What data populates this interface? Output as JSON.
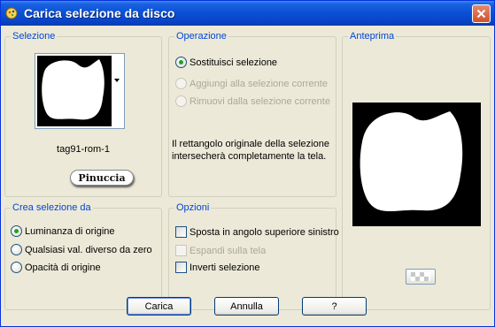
{
  "window": {
    "title": "Carica selezione da disco"
  },
  "selection": {
    "group_label": "Selezione",
    "file_name": "tag91-rom-1",
    "logo_text": "Pinuccia"
  },
  "operation": {
    "group_label": "Operazione",
    "options": [
      {
        "label": "Sostituisci selezione",
        "checked": true,
        "enabled": true
      },
      {
        "label": "Aggiungi alla selezione corrente",
        "checked": false,
        "enabled": false
      },
      {
        "label": "Rimuovi dalla selezione corrente",
        "checked": false,
        "enabled": false
      }
    ],
    "description": "Il rettangolo originale della selezione intersecherà completamente la tela."
  },
  "preview": {
    "group_label": "Anteprima"
  },
  "create_from": {
    "group_label": "Crea selezione da",
    "options": [
      {
        "label": "Luminanza di origine",
        "checked": true
      },
      {
        "label": "Qualsiasi val. diverso da zero",
        "checked": false
      },
      {
        "label": "Opacità di origine",
        "checked": false
      }
    ]
  },
  "options": {
    "group_label": "Opzioni",
    "items": [
      {
        "label": "Sposta in angolo superiore sinistro",
        "checked": false,
        "enabled": true
      },
      {
        "label": "Espandi sulla tela",
        "checked": false,
        "enabled": false
      },
      {
        "label": "Inverti selezione",
        "checked": false,
        "enabled": true
      }
    ]
  },
  "buttons": {
    "load": "Carica",
    "cancel": "Annulla",
    "help": "?"
  },
  "colors": {
    "group_label": "#0046d5",
    "title_bar": "#0a4fd6",
    "radio_dot": "#21a121",
    "disabled_text": "#aca899"
  }
}
